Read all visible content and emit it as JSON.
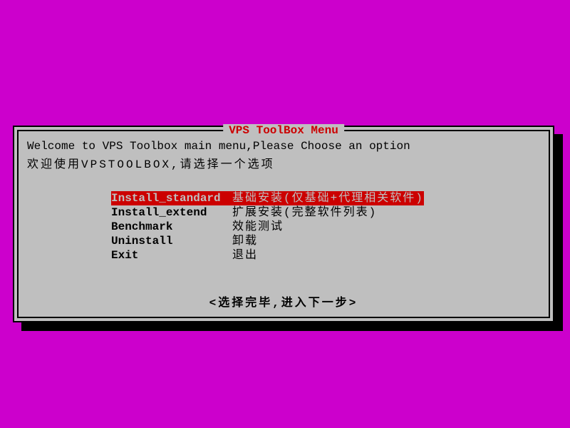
{
  "dialog": {
    "title": "VPS ToolBox Menu",
    "welcome_en": "Welcome to VPS Toolbox main menu,Please Choose an option",
    "welcome_cn": "欢迎使用VPSTOOLBOX,请选择一个选项",
    "prompt": "<选择完毕,进入下一步>"
  },
  "menu": {
    "items": [
      {
        "label": "Install_standard",
        "desc": "基础安装(仅基础+代理相关软件)",
        "selected": true
      },
      {
        "label": "Install_extend",
        "desc": "扩展安装(完整软件列表)",
        "selected": false
      },
      {
        "label": "Benchmark",
        "desc": "效能测试",
        "selected": false
      },
      {
        "label": "Uninstall",
        "desc": "卸载",
        "selected": false
      },
      {
        "label": "Exit",
        "desc": "退出",
        "selected": false
      }
    ]
  }
}
